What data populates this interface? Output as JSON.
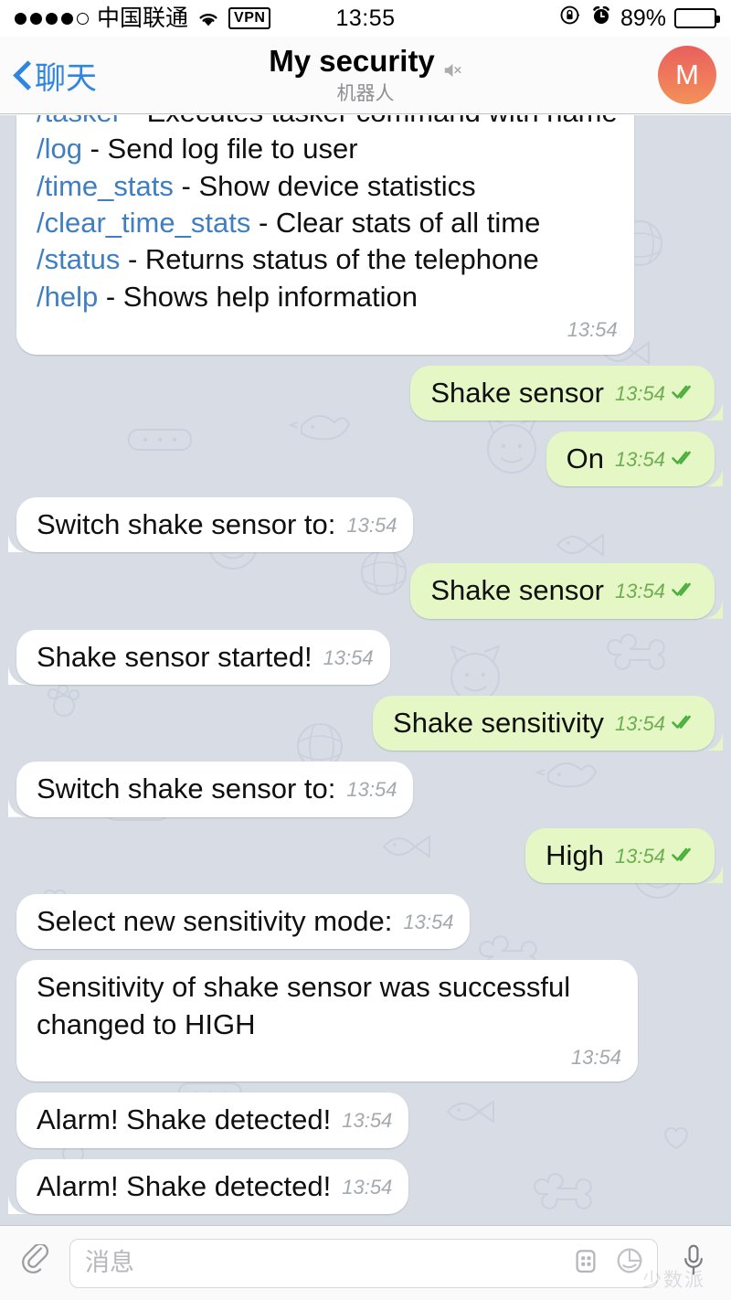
{
  "status_bar": {
    "signal_dots_filled": 4,
    "signal_dots_total": 5,
    "carrier": "中国联通",
    "wifi_icon": "wifi-icon",
    "vpn_label": "VPN",
    "time": "13:55",
    "rotation_lock_icon": "rotation-lock-icon",
    "alarm_icon": "alarm-clock-icon",
    "battery_percent": "89%",
    "battery_level": 89
  },
  "nav_bar": {
    "back_label": "聊天",
    "back_icon": "chevron-left-icon",
    "title": "My security",
    "mute_icon": "speaker-muted-icon",
    "subtitle": "机器人",
    "avatar_initial": "M",
    "avatar_color_top": "#e8605c",
    "avatar_color_bottom": "#f29158"
  },
  "theme": {
    "chat_background": "#d7dce5",
    "incoming_bubble": "#ffffff",
    "outgoing_bubble": "#e4f7c5",
    "link_color": "#3f7fc1",
    "outgoing_meta_color": "#6fad52",
    "incoming_meta_color": "#a4a9ae",
    "accent_blue": "#2f86e0"
  },
  "messages": [
    {
      "id": "m1",
      "direction": "in",
      "tail": false,
      "clipped_top": true,
      "multiline_meta": true,
      "segments": [
        {
          "type": "cmd",
          "text": "/tasker"
        },
        {
          "type": "text",
          "text": " - Executes tasker command with name\n"
        },
        {
          "type": "cmd",
          "text": "/log"
        },
        {
          "type": "text",
          "text": " - Send log file to user\n"
        },
        {
          "type": "cmd",
          "text": "/time_stats"
        },
        {
          "type": "text",
          "text": " - Show device statistics\n"
        },
        {
          "type": "cmd",
          "text": "/clear_time_stats"
        },
        {
          "type": "text",
          "text": " - Clear stats of all time\n"
        },
        {
          "type": "cmd",
          "text": "/status"
        },
        {
          "type": "text",
          "text": " - Returns status of the telephone\n"
        },
        {
          "type": "cmd",
          "text": "/help"
        },
        {
          "type": "text",
          "text": " - Shows help information"
        }
      ],
      "time": "13:54",
      "read": false
    },
    {
      "id": "m2",
      "direction": "out",
      "tail": true,
      "text": "Shake sensor",
      "time": "13:54",
      "read": true
    },
    {
      "id": "m3",
      "direction": "out",
      "tail": true,
      "text": "On",
      "time": "13:54",
      "read": true
    },
    {
      "id": "m4",
      "direction": "in",
      "tail": true,
      "text": "Switch shake sensor to:",
      "time": "13:54",
      "read": false
    },
    {
      "id": "m5",
      "direction": "out",
      "tail": true,
      "text": "Shake sensor",
      "time": "13:54",
      "read": true
    },
    {
      "id": "m6",
      "direction": "in",
      "tail": true,
      "text": "Shake sensor started!",
      "time": "13:54",
      "read": false
    },
    {
      "id": "m7",
      "direction": "out",
      "tail": true,
      "text": "Shake sensitivity",
      "time": "13:54",
      "read": true
    },
    {
      "id": "m8",
      "direction": "in",
      "tail": true,
      "text": "Switch shake sensor to:",
      "time": "13:54",
      "read": false
    },
    {
      "id": "m9",
      "direction": "out",
      "tail": true,
      "text": "High",
      "time": "13:54",
      "read": true
    },
    {
      "id": "m10",
      "direction": "in",
      "tail": false,
      "text": "Select new sensitivity mode:",
      "time": "13:54",
      "read": false
    },
    {
      "id": "m11",
      "direction": "in",
      "tail": false,
      "multiline_meta": true,
      "text": "Sensitivity of shake sensor was successful changed to HIGH",
      "time": "13:54",
      "read": false
    },
    {
      "id": "m12",
      "direction": "in",
      "tail": false,
      "text": "Alarm! Shake detected!",
      "time": "13:54",
      "read": false
    },
    {
      "id": "m13",
      "direction": "in",
      "tail": true,
      "text": "Alarm! Shake detected!",
      "time": "13:54",
      "read": false
    }
  ],
  "input_bar": {
    "attach_icon": "paperclip-icon",
    "placeholder": "消息",
    "value": "",
    "keyboard_icon": "keyboard-grid-icon",
    "sticker_icon": "sticker-icon",
    "mic_icon": "microphone-icon",
    "watermark": "少数派"
  }
}
